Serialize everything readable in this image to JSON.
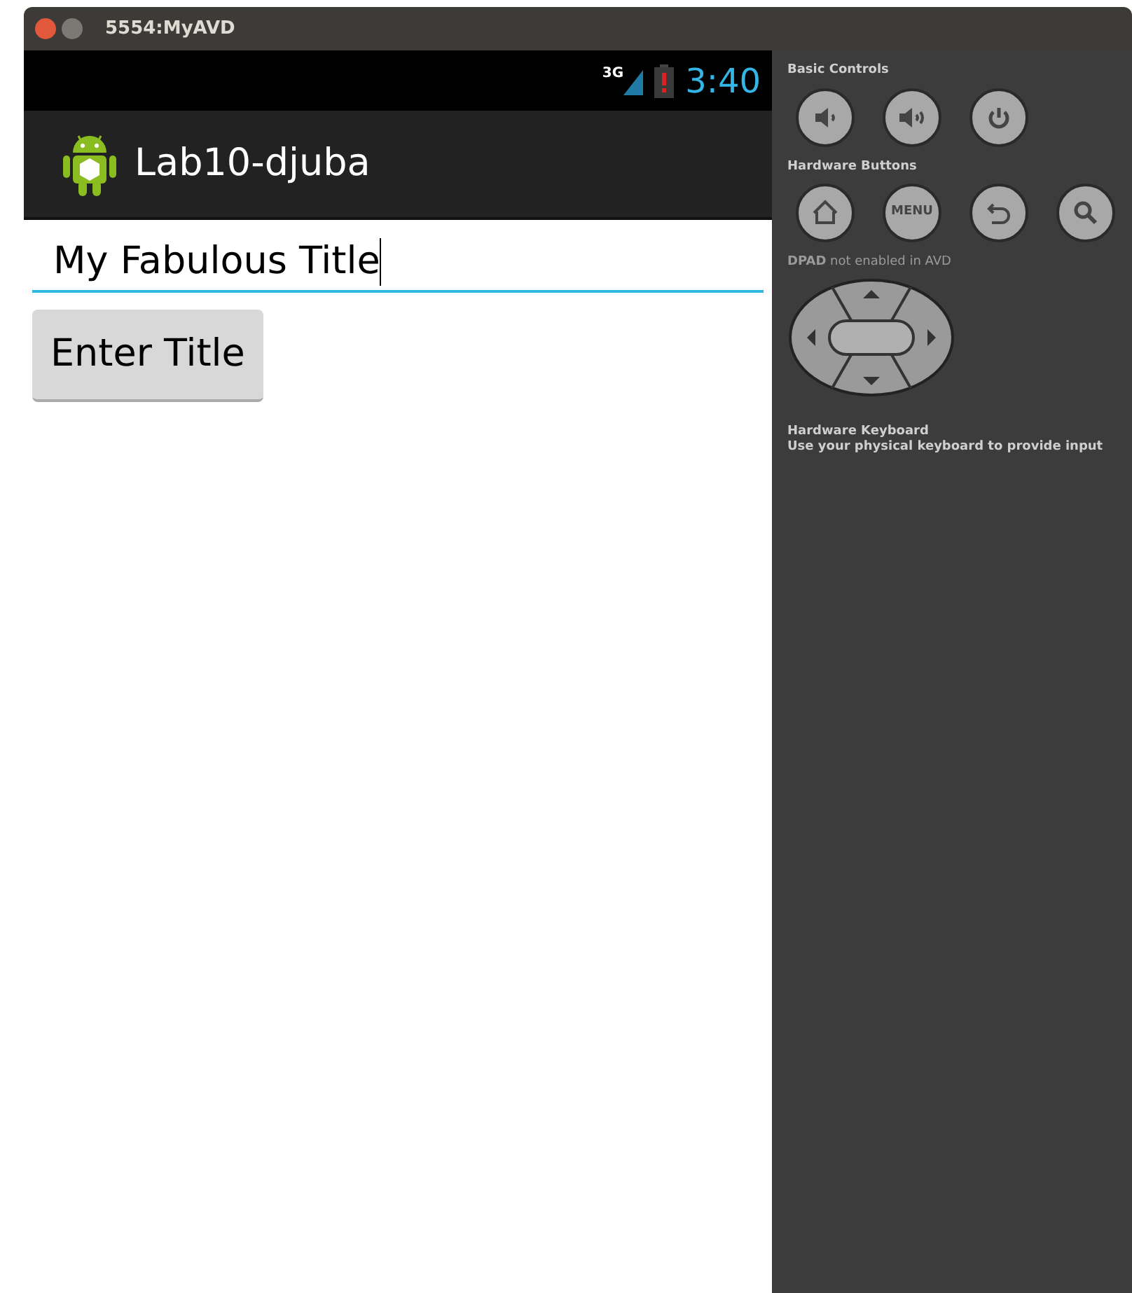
{
  "window": {
    "title": "5554:MyAVD"
  },
  "status_bar": {
    "network": "3G",
    "time": "3:40"
  },
  "action_bar": {
    "title": "Lab10-djuba"
  },
  "form": {
    "title_field": {
      "value": "My Fabulous Title",
      "focused": true
    },
    "button": "Enter Title"
  },
  "controls": {
    "basic_heading": "Basic Controls",
    "basic_buttons": [
      {
        "kind": "volume-down"
      },
      {
        "kind": "volume-up"
      },
      {
        "kind": "power"
      }
    ],
    "hardware_heading": "Hardware Buttons",
    "hardware_buttons": [
      {
        "kind": "home"
      },
      {
        "kind": "text",
        "label": "MENU"
      },
      {
        "kind": "back"
      },
      {
        "kind": "search"
      }
    ],
    "dpad_note": "**DPAD** not enabled in AVD",
    "keyboard_heading": "Hardware Keyboard",
    "keyboard_note": "Use your physical keyboard to provide input"
  }
}
